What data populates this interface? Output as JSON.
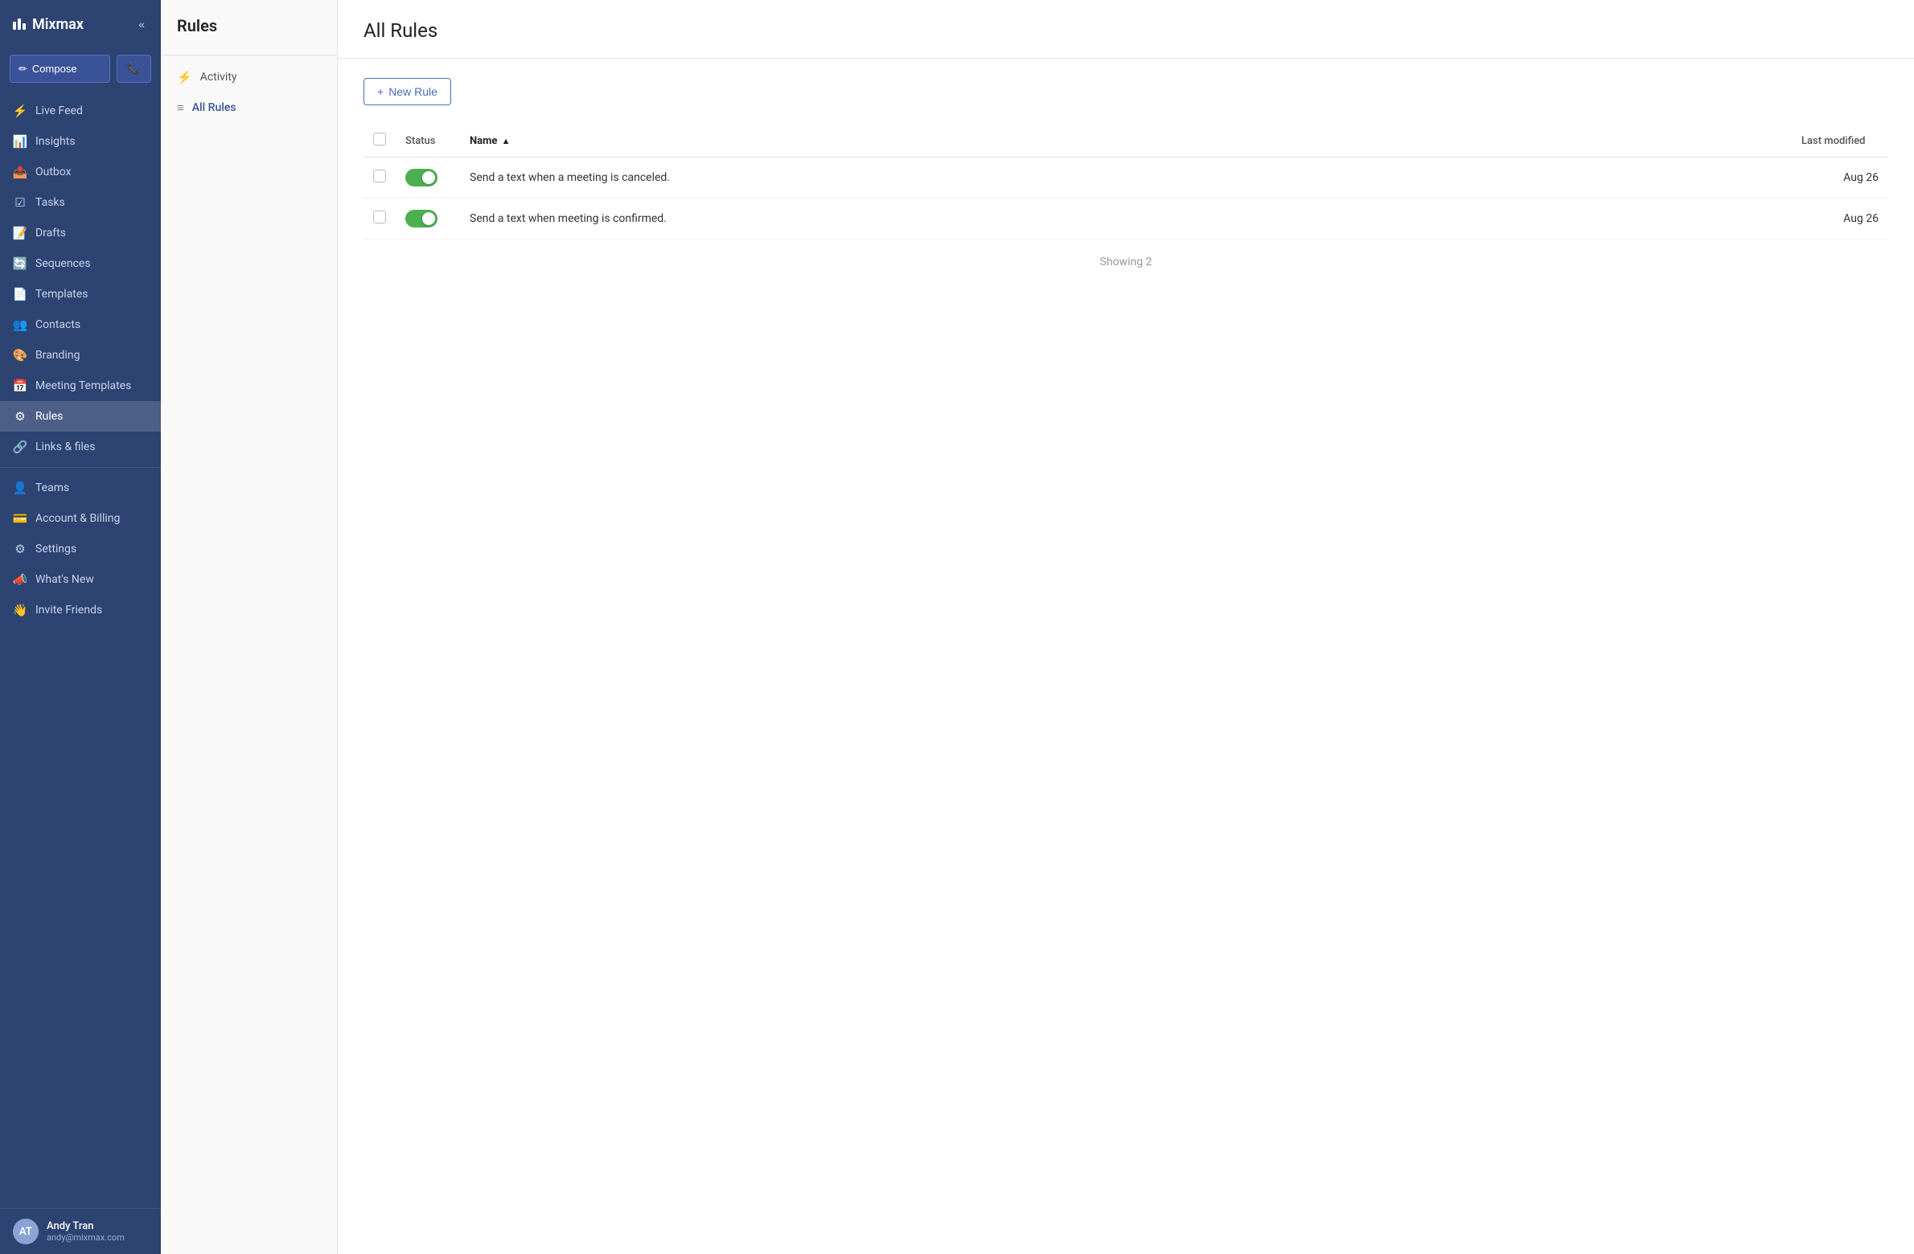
{
  "app": {
    "name": "Mixmax",
    "collapse_label": "«"
  },
  "compose": {
    "label": "Compose",
    "phone_icon": "📞"
  },
  "sidebar": {
    "items": [
      {
        "id": "live-feed",
        "label": "Live Feed",
        "icon": "⚡"
      },
      {
        "id": "insights",
        "label": "Insights",
        "icon": "📊"
      },
      {
        "id": "outbox",
        "label": "Outbox",
        "icon": "📤"
      },
      {
        "id": "tasks",
        "label": "Tasks",
        "icon": "☑"
      },
      {
        "id": "drafts",
        "label": "Drafts",
        "icon": "📝"
      },
      {
        "id": "sequences",
        "label": "Sequences",
        "icon": "🔄"
      },
      {
        "id": "templates",
        "label": "Templates",
        "icon": "📄"
      },
      {
        "id": "contacts",
        "label": "Contacts",
        "icon": "👥"
      },
      {
        "id": "branding",
        "label": "Branding",
        "icon": "🎨"
      },
      {
        "id": "meeting-templates",
        "label": "Meeting Templates",
        "icon": "📅"
      },
      {
        "id": "rules",
        "label": "Rules",
        "icon": "⚙"
      },
      {
        "id": "links-files",
        "label": "Links & files",
        "icon": "🔗"
      },
      {
        "id": "teams",
        "label": "Teams",
        "icon": "👤"
      },
      {
        "id": "account-billing",
        "label": "Account & Billing",
        "icon": "💳"
      },
      {
        "id": "settings",
        "label": "Settings",
        "icon": "⚙"
      },
      {
        "id": "whats-new",
        "label": "What's New",
        "icon": "📣"
      },
      {
        "id": "invite-friends",
        "label": "Invite Friends",
        "icon": "👋"
      }
    ]
  },
  "user": {
    "name": "Andy Tran",
    "email": "andy@mixmax.com",
    "initials": "AT"
  },
  "subnav": {
    "title": "Rules",
    "items": [
      {
        "id": "activity",
        "label": "Activity",
        "icon": "⚡"
      },
      {
        "id": "all-rules",
        "label": "All Rules",
        "icon": "≡",
        "active": true
      }
    ]
  },
  "main": {
    "title": "All Rules",
    "new_rule_label": "New Rule",
    "table": {
      "columns": [
        {
          "id": "status",
          "label": "Status"
        },
        {
          "id": "name",
          "label": "Name",
          "sorted": true
        },
        {
          "id": "last_modified",
          "label": "Last modified"
        }
      ],
      "rows": [
        {
          "id": 1,
          "status": true,
          "name": "Send a text when a meeting is canceled.",
          "last_modified": "Aug 26"
        },
        {
          "id": 2,
          "status": true,
          "name": "Send a text when meeting is confirmed.",
          "last_modified": "Aug 26"
        }
      ],
      "showing_label": "Showing 2"
    }
  }
}
